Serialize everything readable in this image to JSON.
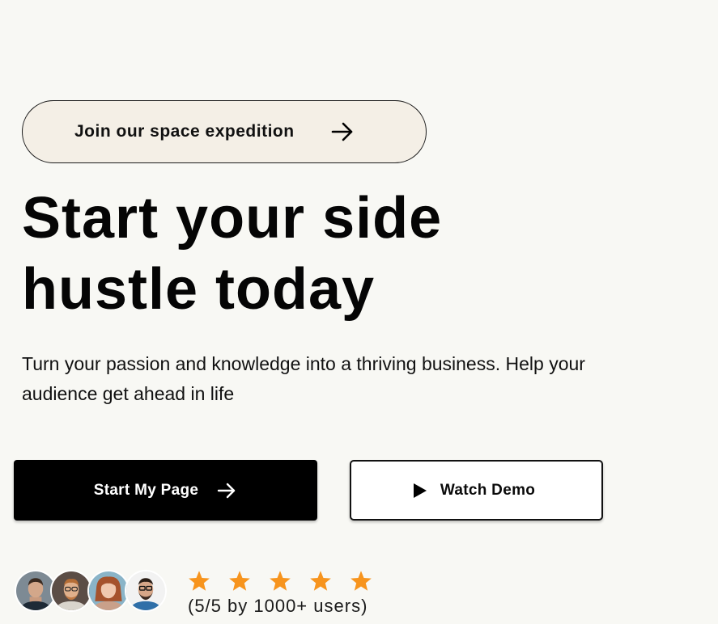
{
  "hero": {
    "pill_label": "Join our space expedition",
    "pill_icon": "arrow-right-icon",
    "headline_line1": "Start your side",
    "headline_line2": "hustle today",
    "subtext": "Turn your passion and knowledge into a thriving business. Help your audience get ahead in life"
  },
  "actions": {
    "primary_label": "Start My Page",
    "primary_icon": "arrow-right-icon",
    "secondary_label": "Watch Demo",
    "secondary_icon": "play-icon"
  },
  "social_proof": {
    "avatars": [
      "user-avatar-1",
      "user-avatar-2",
      "user-avatar-3",
      "user-avatar-4"
    ],
    "stars": 5,
    "star_color": "#f7941d",
    "rating_text": "(5/5 by 1000+ users)"
  },
  "colors": {
    "background": "#f8f8f4",
    "pill_background": "#f4efe6",
    "primary_button": "#000000",
    "secondary_button": "#ffffff"
  }
}
